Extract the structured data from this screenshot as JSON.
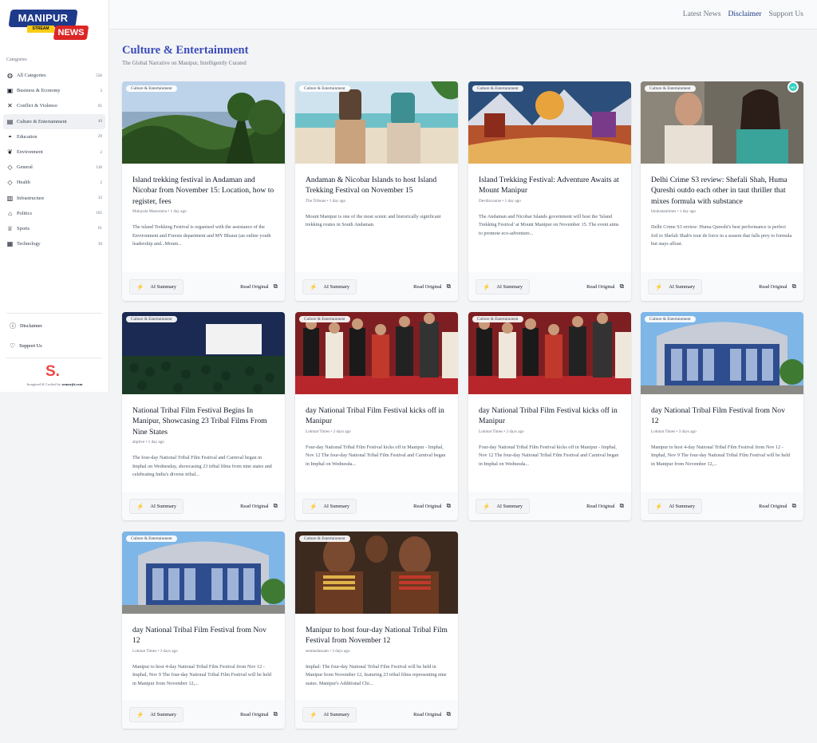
{
  "brand": {
    "top": "MANIPUR",
    "stream": "STREAM",
    "bottom": "NEWS"
  },
  "nav": {
    "latest": "Latest News",
    "disclaimer": "Disclaimer",
    "support": "Support Us"
  },
  "sidebar": {
    "heading": "Categories",
    "items": [
      {
        "label": "All Categories",
        "count": "556",
        "icon": "globe-icon"
      },
      {
        "label": "Business & Economy",
        "count": "3",
        "icon": "briefcase-icon"
      },
      {
        "label": "Conflict & Violence",
        "count": "65",
        "icon": "swords-icon"
      },
      {
        "label": "Culture & Entertainment",
        "count": "49",
        "icon": "film-icon"
      },
      {
        "label": "Education",
        "count": "29",
        "icon": "graduation-cap-icon"
      },
      {
        "label": "Environment",
        "count": "2",
        "icon": "leaf-icon"
      },
      {
        "label": "General",
        "count": "130",
        "icon": "tag-icon"
      },
      {
        "label": "Health",
        "count": "2",
        "icon": "tag-icon"
      },
      {
        "label": "Infrastructure",
        "count": "33",
        "icon": "building-icon"
      },
      {
        "label": "Politics",
        "count": "165",
        "icon": "landmark-icon"
      },
      {
        "label": "Sports",
        "count": "61",
        "icon": "trophy-icon"
      },
      {
        "label": "Technology",
        "count": "39",
        "icon": "cpu-icon"
      }
    ],
    "disclaimer": "Disclaimer",
    "support": "Support Us",
    "logo_mark": "S.",
    "credits_prefix": "Imagined & Crafted by",
    "credits_link": "somorjit.com"
  },
  "page": {
    "title": "Culture & Entertainment",
    "subtitle": "The Global Narrative on Manipur, Intelligently Curated"
  },
  "labels": {
    "ai_summary": "AI Summary",
    "read_original": "Read Original"
  },
  "cards": [
    {
      "tag": "Culture & Entertainment",
      "title": "Island trekking festival in Andaman and Nicobar from November 15: Location, how to register, fees",
      "meta": "Malayala Manorama • 1 day ago",
      "excerpt": "The island Trekking Festival is organised with the assistance of the Environment and Forests department and MY Bharat (an online youth leadership and...Mount...",
      "scene": "forest"
    },
    {
      "tag": "Culture & Entertainment",
      "title": "Andaman & Nicobar Islands to host Island Trekking Festival on November 15",
      "meta": "The Tribune • 1 day ago",
      "excerpt": "Mount Manipur is one of the most scenic and historically significant trekking routes in South Andaman.",
      "scene": "beach"
    },
    {
      "tag": "Culture & Entertainment",
      "title": "Island Trekking Festival: Adventure Awaits at Mount Manipur",
      "meta": "Devdiscourse • 1 day ago",
      "excerpt": "The Andaman and Nicobar Islands government will host the 'Island Trekking Festival' at Mount Manipur on November 15. The event aims to promote eco-adventure...",
      "scene": "art"
    },
    {
      "tag": "Culture & Entertainment",
      "title": "Delhi Crime S3 review: Shefali Shah, Huma Qureshi outdo each other in taut thriller that mixes formula with substance",
      "meta": "hindustantimes • 1 day ago",
      "excerpt": "Delhi Crime S3 review: Huma Qureshi's best performance is perfect foil to Shefali Shah's tour de force in a season that falls prey to formula but stays afloat.",
      "scene": "people",
      "badge": "HT"
    },
    {
      "tag": "Culture & Entertainment",
      "title": "National Tribal Film Festival Begins In Manipur, Showcasing 23 Tribal Films From Nine States",
      "meta": "abplive • 1 day ago",
      "excerpt": "The four-day National Tribal Film Festival and Carnival began in Imphal on Wednesday, showcasing 23 tribal films from nine states and celebrating India's diverse tribal...",
      "scene": "cinema"
    },
    {
      "tag": "Culture & Entertainment",
      "title": "day National Tribal Film Festival kicks off in Manipur",
      "meta": "Lokmat Times • 2 days ago",
      "excerpt": "Four-day National Tribal Film Festival kicks off in Manipur - Imphal, Nov 12 The four-day National Tribal Film Festival and Carnival began in Imphal on Wednesda...",
      "scene": "crowd"
    },
    {
      "tag": "Culture & Entertainment",
      "title": "day National Tribal Film Festival kicks off in Manipur",
      "meta": "Lokmat Times • 2 days ago",
      "excerpt": "Four-day National Tribal Film Festival kicks off in Manipur - Imphal, Nov 12 The four-day National Tribal Film Festival and Carnival began in Imphal on Wednesda...",
      "scene": "crowd"
    },
    {
      "tag": "Culture & Entertainment",
      "title": "day National Tribal Film Festival from Nov 12",
      "meta": "Lokmat Times • 3 days ago",
      "excerpt": "Manipur to host 4-day National Tribal Film Festival from Nov 12 - Imphal, Nov 9 The four-day National Tribal Film Festival will be held in Manipur from November 12,...",
      "scene": "building"
    },
    {
      "tag": "Culture & Entertainment",
      "title": "day National Tribal Film Festival from Nov 12",
      "meta": "Lokmat Times • 3 days ago",
      "excerpt": "Manipur to host 4-day National Tribal Film Festival from Nov 12 - Imphal, Nov 9 The four-day National Tribal Film Festival will be held in Manipur from November 12,...",
      "scene": "building"
    },
    {
      "tag": "Culture & Entertainment",
      "title": "Manipur to host four-day National Tribal Film Festival from November 12",
      "meta": "sentinelassam • 3 days ago",
      "excerpt": "Imphal: The four-day National Tribal Film Festival will be held in Manipur from November 12, featuring 23 tribal films representing nine states. Manipur's Additional Chi...",
      "scene": "tribal"
    }
  ]
}
